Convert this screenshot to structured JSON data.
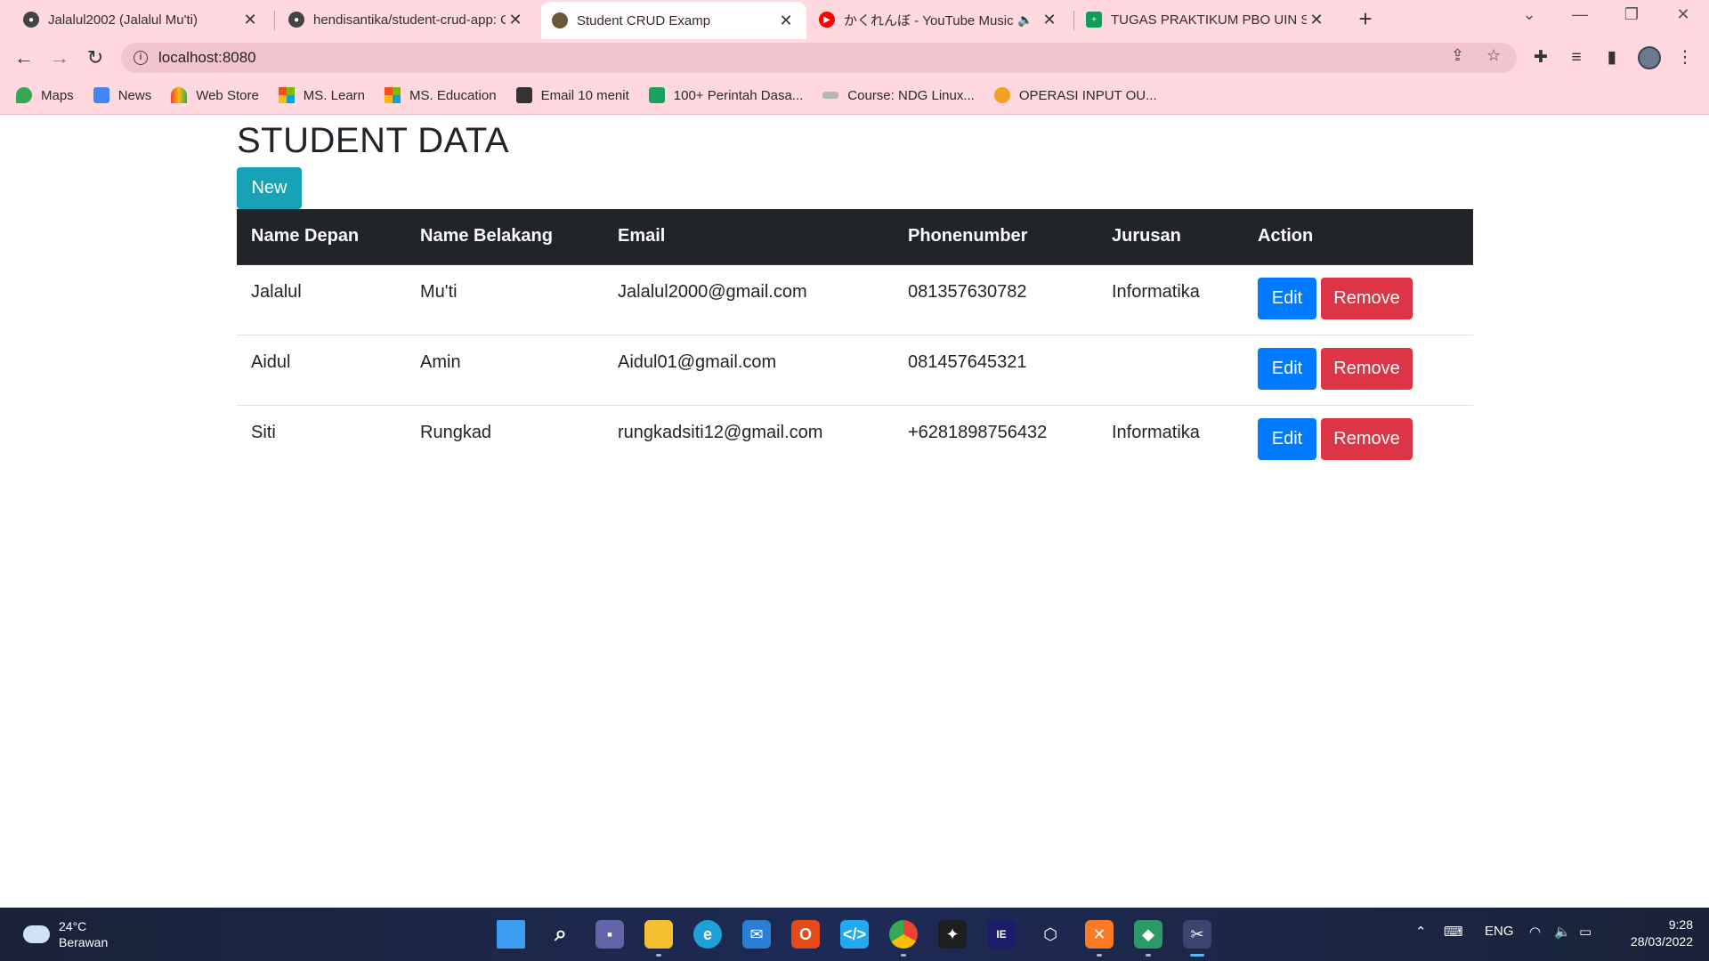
{
  "browser": {
    "tabs": [
      {
        "title": "Jalalul2002 (Jalalul Mu'ti)",
        "icon": "github-icon",
        "active": false
      },
      {
        "title": "hendisantika/student-crud-app: C",
        "icon": "github-icon",
        "active": false
      },
      {
        "title": "Student CRUD Examp",
        "icon": "site-icon",
        "active": true
      },
      {
        "title": "かくれんぼ - YouTube Music",
        "icon": "youtube-music-icon",
        "active": false,
        "audio": true
      },
      {
        "title": "TUGAS PRAKTIKUM PBO UIN SGD",
        "icon": "sheets-icon",
        "active": false
      }
    ],
    "new_tab_symbol": "+",
    "url": "localhost:8080",
    "bookmarks": [
      {
        "label": "Maps",
        "color": "#34a853"
      },
      {
        "label": "News",
        "color": "#4285f4"
      },
      {
        "label": "Web Store",
        "color": "#ea4335"
      },
      {
        "label": "MS. Learn",
        "color": "#f25022"
      },
      {
        "label": "MS. Education",
        "color": "#f25022"
      },
      {
        "label": "Email 10 menit",
        "color": "#333333"
      },
      {
        "label": "100+ Perintah Dasa...",
        "color": "#1aa260"
      },
      {
        "label": "Course: NDG Linux...",
        "color": "#8a8a8a"
      },
      {
        "label": "OPERASI INPUT OU...",
        "color": "#f4a023"
      }
    ]
  },
  "page": {
    "title": "STUDENT DATA",
    "new_button": "New",
    "table": {
      "headers": [
        "Name Depan",
        "Name Belakang",
        "Email",
        "Phonenumber",
        "Jurusan",
        "Action"
      ],
      "rows": [
        {
          "first": "Jalalul",
          "last": "Mu'ti",
          "email": "Jalalul2000@gmail.com",
          "phone": "081357630782",
          "major": "Informatika"
        },
        {
          "first": "Aidul",
          "last": "Amin",
          "email": "Aidul01@gmail.com",
          "phone": "081457645321",
          "major": ""
        },
        {
          "first": "Siti",
          "last": "Rungkad",
          "email": "rungkadsiti12@gmail.com",
          "phone": "+6281898756432",
          "major": "Informatika"
        }
      ],
      "edit_label": "Edit",
      "remove_label": "Remove"
    }
  },
  "taskbar": {
    "weather_temp": "24°C",
    "weather_desc": "Berawan",
    "language": "ENG",
    "time": "9:28",
    "date": "28/03/2022"
  },
  "colors": {
    "chrome_bg": "#ffd8e0",
    "new_button": "#17a2b8",
    "edit_button": "#007bff",
    "remove_button": "#dc3545",
    "table_header": "#212529"
  }
}
